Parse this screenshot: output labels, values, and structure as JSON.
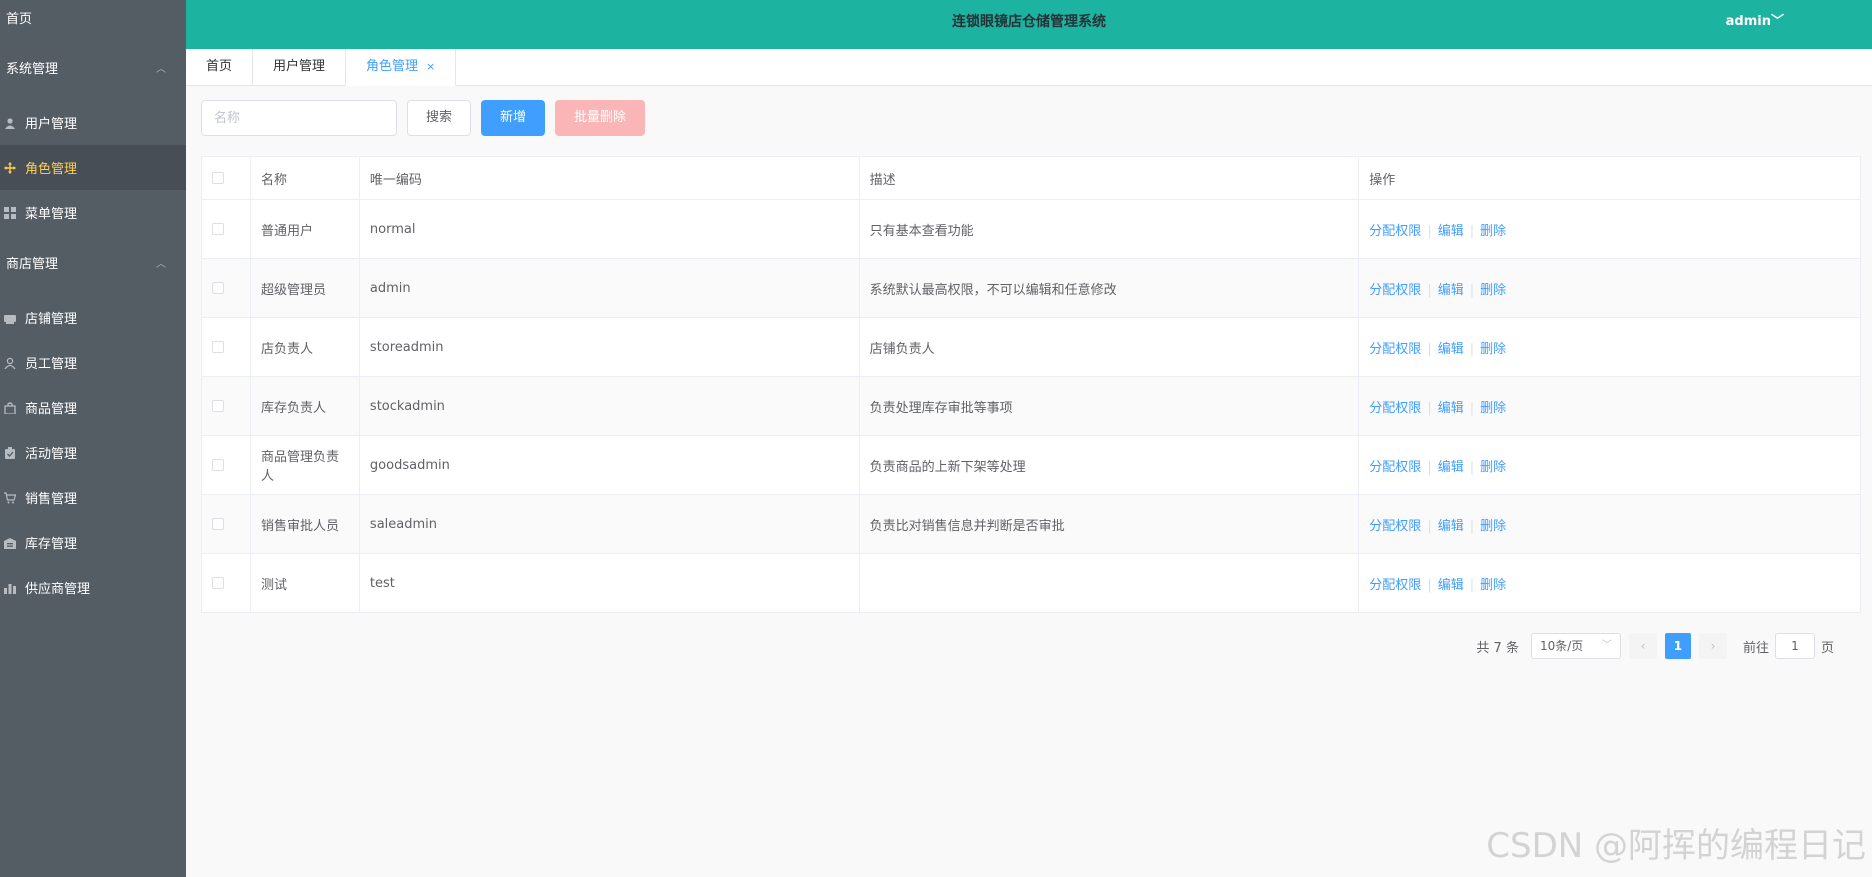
{
  "sidebar": {
    "home": "首页",
    "groups": [
      {
        "label": "系统管理",
        "items": [
          {
            "label": "用户管理",
            "icon": "user-icon"
          },
          {
            "label": "角色管理",
            "icon": "move-icon",
            "active": true
          },
          {
            "label": "菜单管理",
            "icon": "grid-icon"
          }
        ]
      },
      {
        "label": "商店管理",
        "items": [
          {
            "label": "店铺管理",
            "icon": "shop-icon"
          },
          {
            "label": "员工管理",
            "icon": "user-icon"
          },
          {
            "label": "商品管理",
            "icon": "goods-icon"
          },
          {
            "label": "活动管理",
            "icon": "clipboard-icon"
          },
          {
            "label": "销售管理",
            "icon": "cart-icon"
          },
          {
            "label": "库存管理",
            "icon": "warehouse-icon"
          },
          {
            "label": "供应商管理",
            "icon": "bar-chart-icon"
          }
        ]
      }
    ]
  },
  "header": {
    "title": "连锁眼镜店仓储管理系统",
    "user": "admin"
  },
  "tabs": [
    {
      "label": "首页"
    },
    {
      "label": "用户管理"
    },
    {
      "label": "角色管理",
      "active": true,
      "close": "×"
    }
  ],
  "toolbar": {
    "search_placeholder": "名称",
    "search_label": "搜索",
    "add_label": "新增",
    "batch_delete_label": "批量删除"
  },
  "table": {
    "headers": [
      "名称",
      "唯一编码",
      "描述",
      "操作"
    ],
    "rows": [
      {
        "name": "普通用户",
        "code": "normal",
        "desc": "只有基本查看功能"
      },
      {
        "name": "超级管理员",
        "code": "admin",
        "desc": "系统默认最高权限，不可以编辑和任意修改"
      },
      {
        "name": "店负责人",
        "code": "storeadmin",
        "desc": "店铺负责人"
      },
      {
        "name": "库存负责人",
        "code": "stockadmin",
        "desc": "负责处理库存审批等事项"
      },
      {
        "name": "商品管理负责人",
        "code": "goodsadmin",
        "desc": "负责商品的上新下架等处理"
      },
      {
        "name": "销售审批人员",
        "code": "saleadmin",
        "desc": "负责比对销售信息并判断是否审批"
      },
      {
        "name": "测试",
        "code": "test",
        "desc": ""
      }
    ],
    "actions": {
      "assign": "分配权限",
      "edit": "编辑",
      "delete": "删除",
      "separator": "|"
    }
  },
  "pagination": {
    "total": "共 7 条",
    "page_size": "10条/页",
    "current_page": "1",
    "goto_label": "前往",
    "goto_value": "1",
    "page_unit": "页"
  },
  "watermark": "CSDN @阿挥的编程日记",
  "colors": {
    "header": "#1db3a1",
    "sidebar": "#545c64",
    "primary": "#409eff",
    "active_menu": "#ffd04b"
  }
}
